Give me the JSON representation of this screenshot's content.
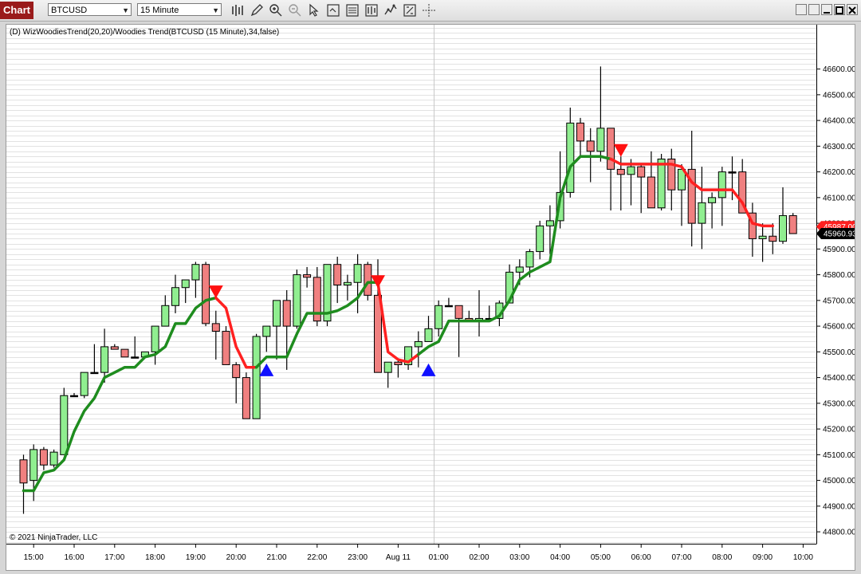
{
  "toolbar": {
    "chart_label": "Chart",
    "instrument": "BTCUSD",
    "interval": "15 Minute",
    "tools": [
      "bar-type-icon",
      "pencil-icon",
      "zoom-in-icon",
      "zoom-out-icon",
      "pointer-icon",
      "properties-icon",
      "indicators-icon",
      "strategies-icon",
      "data-box-icon",
      "crosshair-icon"
    ]
  },
  "colors": {
    "up_candle": "#90ee90",
    "down_candle": "#f08080",
    "trend_up": "#1e8c1e",
    "trend_down": "#ff2020",
    "buy_arrow": "#1010ff",
    "sell_arrow": "#ff1010",
    "grid": "#e2e2e2",
    "price_marker_red": "#ff1f1f",
    "price_marker_black": "#000000"
  },
  "chart_data": {
    "type": "candlestick",
    "indicator_label": "(D) WizWoodiesTrend(20,20)/Woodies Trend(BTCUSD (15 Minute),34,false)",
    "copyright": "© 2021 NinjaTrader, LLC",
    "ylim": [
      44760,
      46760
    ],
    "y_ticks": [
      "44800.00",
      "44900.00",
      "45000.00",
      "45100.00",
      "45200.00",
      "45300.00",
      "45400.00",
      "45500.00",
      "45600.00",
      "45700.00",
      "45800.00",
      "45900.00",
      "46000.00",
      "46100.00",
      "46200.00",
      "46300.00",
      "46400.00",
      "46500.00",
      "46600.00"
    ],
    "x_ticks": [
      {
        "label": "15:00",
        "bar": 1
      },
      {
        "label": "16:00",
        "bar": 5
      },
      {
        "label": "17:00",
        "bar": 9
      },
      {
        "label": "18:00",
        "bar": 13
      },
      {
        "label": "19:00",
        "bar": 17
      },
      {
        "label": "20:00",
        "bar": 21
      },
      {
        "label": "21:00",
        "bar": 25
      },
      {
        "label": "22:00",
        "bar": 29
      },
      {
        "label": "23:00",
        "bar": 33
      },
      {
        "label": "Aug 11",
        "bar": 37
      },
      {
        "label": "01:00",
        "bar": 41
      },
      {
        "label": "02:00",
        "bar": 45
      },
      {
        "label": "03:00",
        "bar": 49
      },
      {
        "label": "04:00",
        "bar": 53
      },
      {
        "label": "05:00",
        "bar": 57
      },
      {
        "label": "06:00",
        "bar": 61
      },
      {
        "label": "07:00",
        "bar": 65
      },
      {
        "label": "08:00",
        "bar": 69
      },
      {
        "label": "09:00",
        "bar": 73
      },
      {
        "label": "10:00",
        "bar": 77
      }
    ],
    "session_break_bar": 40.5,
    "candles": [
      [
        45080,
        45100,
        44870,
        44990
      ],
      [
        45000,
        45140,
        44920,
        45120
      ],
      [
        45120,
        45130,
        45040,
        45060
      ],
      [
        45060,
        45120,
        45050,
        45110
      ],
      [
        45100,
        45360,
        45100,
        45330
      ],
      [
        45330,
        45340,
        45330,
        45330
      ],
      [
        45330,
        45380,
        45320,
        45420
      ],
      [
        45420,
        45530,
        45420,
        45420
      ],
      [
        45420,
        45590,
        45380,
        45520
      ],
      [
        45520,
        45530,
        45510,
        45510
      ],
      [
        45510,
        45500,
        45480,
        45480
      ],
      [
        45480,
        45560,
        45480,
        45480
      ],
      [
        45480,
        45500,
        45480,
        45500
      ],
      [
        45500,
        45600,
        45450,
        45600
      ],
      [
        45600,
        45720,
        45600,
        45680
      ],
      [
        45680,
        45800,
        45650,
        45750
      ],
      [
        45750,
        45780,
        45690,
        45780
      ],
      [
        45780,
        45850,
        45710,
        45840
      ],
      [
        45840,
        45850,
        45600,
        45610
      ],
      [
        45610,
        45660,
        45470,
        45580
      ],
      [
        45580,
        45600,
        45450,
        45450
      ],
      [
        45450,
        45460,
        45300,
        45400
      ],
      [
        45400,
        45420,
        45240,
        45240
      ],
      [
        45240,
        45570,
        45240,
        45560
      ],
      [
        45560,
        45600,
        45500,
        45600
      ],
      [
        45600,
        45700,
        45470,
        45700
      ],
      [
        45700,
        45740,
        45430,
        45600
      ],
      [
        45600,
        45820,
        45590,
        45800
      ],
      [
        45800,
        45830,
        45750,
        45790
      ],
      [
        45790,
        45830,
        45600,
        45620
      ],
      [
        45620,
        45840,
        45600,
        45840
      ],
      [
        45840,
        45870,
        45690,
        45760
      ],
      [
        45760,
        45800,
        45700,
        45770
      ],
      [
        45770,
        45880,
        45650,
        45840
      ],
      [
        45840,
        45850,
        45700,
        45720
      ],
      [
        45720,
        45860,
        45570,
        45420
      ],
      [
        45420,
        45460,
        45360,
        45460
      ],
      [
        45460,
        45470,
        45400,
        45450
      ],
      [
        45450,
        45460,
        45430,
        45520
      ],
      [
        45520,
        45580,
        45440,
        45540
      ],
      [
        45540,
        45640,
        45540,
        45590
      ],
      [
        45590,
        45700,
        45560,
        45680
      ],
      [
        45680,
        45710,
        45680,
        45680
      ],
      [
        45680,
        45680,
        45480,
        45630
      ],
      [
        45630,
        45660,
        45620,
        45620
      ],
      [
        45620,
        45740,
        45560,
        45630
      ],
      [
        45630,
        45680,
        45620,
        45630
      ],
      [
        45630,
        45700,
        45600,
        45690
      ],
      [
        45690,
        45840,
        45690,
        45810
      ],
      [
        45810,
        45860,
        45760,
        45830
      ],
      [
        45830,
        45900,
        45790,
        45890
      ],
      [
        45890,
        46010,
        45860,
        45990
      ],
      [
        45990,
        46070,
        45880,
        46010
      ],
      [
        46010,
        46280,
        45980,
        46120
      ],
      [
        46120,
        46450,
        46100,
        46390
      ],
      [
        46390,
        46410,
        46260,
        46320
      ],
      [
        46320,
        46370,
        46160,
        46280
      ],
      [
        46280,
        46610,
        46240,
        46370
      ],
      [
        46370,
        46370,
        46050,
        46210
      ],
      [
        46210,
        46260,
        46050,
        46190
      ],
      [
        46190,
        46250,
        46070,
        46220
      ],
      [
        46220,
        46230,
        46040,
        46180
      ],
      [
        46180,
        46280,
        46060,
        46060
      ],
      [
        46060,
        46270,
        46050,
        46250
      ],
      [
        46250,
        46290,
        46050,
        46130
      ],
      [
        46130,
        46230,
        45990,
        46210
      ],
      [
        46210,
        46360,
        45910,
        46000
      ],
      [
        46000,
        46220,
        45900,
        46080
      ],
      [
        46080,
        46120,
        45980,
        46100
      ],
      [
        46100,
        46220,
        45990,
        46200
      ],
      [
        46200,
        46260,
        46090,
        46200
      ],
      [
        46200,
        46250,
        46080,
        46040
      ],
      [
        46040,
        46080,
        45870,
        45940
      ],
      [
        45940,
        46000,
        45850,
        45950
      ],
      [
        45950,
        46000,
        45880,
        45930
      ],
      [
        45930,
        46140,
        45920,
        46030
      ],
      [
        46030,
        46040,
        45960,
        45960
      ]
    ],
    "trend_line": [
      44960,
      44960,
      45030,
      45040,
      45080,
      45190,
      45270,
      45320,
      45400,
      45420,
      45440,
      45440,
      45480,
      45490,
      45520,
      45610,
      45610,
      45670,
      45700,
      45710,
      45670,
      45520,
      45440,
      45440,
      45480,
      45480,
      45480,
      45570,
      45650,
      45650,
      45650,
      45660,
      45680,
      45710,
      45770,
      45770,
      45500,
      45470,
      45460,
      45490,
      45520,
      45540,
      45620,
      45620,
      45620,
      45620,
      45620,
      45640,
      45700,
      45780,
      45810,
      45830,
      45850,
      46100,
      46220,
      46260,
      46260,
      46260,
      46250,
      46230,
      46230,
      46230,
      46230,
      46230,
      46230,
      46220,
      46160,
      46130,
      46130,
      46130,
      46130,
      46080,
      46000,
      45990,
      45990
    ],
    "trend_color_switches": [
      {
        "from": 0,
        "to": 19,
        "color": "up"
      },
      {
        "from": 19,
        "to": 23,
        "color": "down"
      },
      {
        "from": 23,
        "to": 35,
        "color": "up"
      },
      {
        "from": 35,
        "to": 39,
        "color": "down"
      },
      {
        "from": 39,
        "to": 58,
        "color": "up"
      },
      {
        "from": 58,
        "to": 76,
        "color": "down"
      }
    ],
    "signals": [
      {
        "bar": 19,
        "type": "sell",
        "price": 45730
      },
      {
        "bar": 24,
        "type": "buy",
        "price": 45430
      },
      {
        "bar": 35,
        "type": "sell",
        "price": 45770
      },
      {
        "bar": 40,
        "type": "buy",
        "price": 45430
      },
      {
        "bar": 59,
        "type": "sell",
        "price": 46280
      }
    ],
    "price_markers": [
      {
        "value": "45987.00",
        "price": 45987,
        "color": "red"
      },
      {
        "value": "45960.93",
        "price": 45960,
        "color": "black"
      }
    ]
  }
}
